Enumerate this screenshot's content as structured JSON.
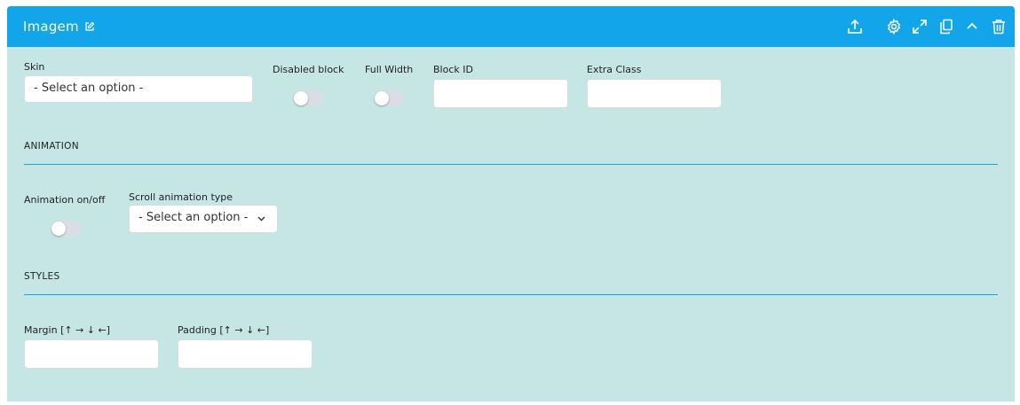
{
  "header": {
    "title": "Imagem",
    "icons": [
      "edit-icon",
      "upload-icon",
      "gear-icon",
      "expand-icon",
      "copy-icon",
      "chevron-up-icon",
      "trash-icon"
    ]
  },
  "fields": {
    "skin": {
      "label": "Skin",
      "value": "- Select an option -"
    },
    "disabled_block": {
      "label": "Disabled block",
      "on": false
    },
    "full_width": {
      "label": "Full Width",
      "on": false
    },
    "block_id": {
      "label": "Block ID",
      "value": ""
    },
    "extra_class": {
      "label": "Extra Class",
      "value": ""
    }
  },
  "animation": {
    "section_title": "ANIMATION",
    "toggle_label": "Animation on/off",
    "toggle_on": false,
    "scroll_label": "Scroll animation type",
    "scroll_value": "- Select an option -"
  },
  "styles": {
    "section_title": "STYLES",
    "margin_label": "Margin [↑ → ↓ ←]",
    "margin_value": "",
    "padding_label": "Padding [↑ → ↓ ←]",
    "padding_value": ""
  },
  "colors": {
    "header_bg": "#12a5e9",
    "panel_bg": "#c5e6e5",
    "divider": "#12a5e9"
  }
}
